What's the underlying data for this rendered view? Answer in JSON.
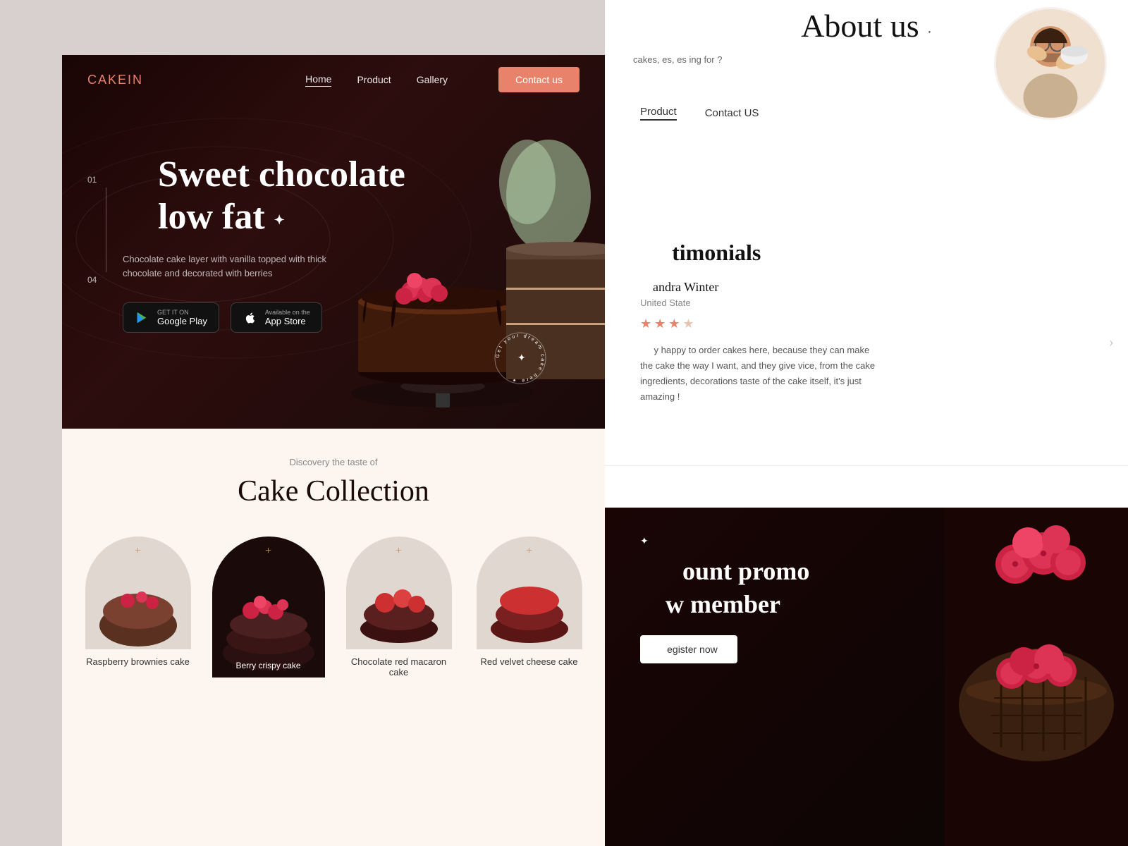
{
  "brand": {
    "name_part1": "CAKE",
    "name_part2": "IN"
  },
  "nav": {
    "home": "Home",
    "product": "Product",
    "gallery": "Gallery",
    "contact_btn": "Contact us"
  },
  "hero": {
    "slide_start": "01",
    "slide_end": "04",
    "title_line1": "Sweet chocolate",
    "title_line2": "low fat",
    "star": "✦",
    "description": "Chocolate cake layer with vanilla topped with thick chocolate and decorated with berries",
    "circular_text": "Get your dream cake here",
    "google_play_small": "GET IT ON",
    "google_play_large": "Google Play",
    "app_store_small": "Available on the",
    "app_store_large": "App Store"
  },
  "collection": {
    "subtitle": "Discovery the taste of",
    "title": "Cake Collection",
    "cards": [
      {
        "name": "Raspberry brownies cake",
        "featured": false
      },
      {
        "name": "Berry crispy cake",
        "featured": true
      },
      {
        "name": "Chocolate red macaron cake",
        "featured": false
      },
      {
        "name": "Red velvet cheese cake",
        "featured": false
      }
    ]
  },
  "about": {
    "title": "About us",
    "dot": "·",
    "text_partial": "cakes, es, es ing for ?"
  },
  "nav_right": {
    "product": "Product",
    "contact": "Contact US"
  },
  "testimonials": {
    "title": "timonials",
    "reviewer_name": "andra Winter",
    "reviewer_country": "United State",
    "stars": 3.5,
    "review_text": "y happy to order cakes here, because they can make the cake the way I want, and they give vice, from the cake ingredients, decorations taste of the cake itself, it's just amazing !"
  },
  "promo": {
    "star": "✦",
    "title_line1": "ount promo",
    "title_line2": "w member",
    "btn_label": "egister now"
  }
}
